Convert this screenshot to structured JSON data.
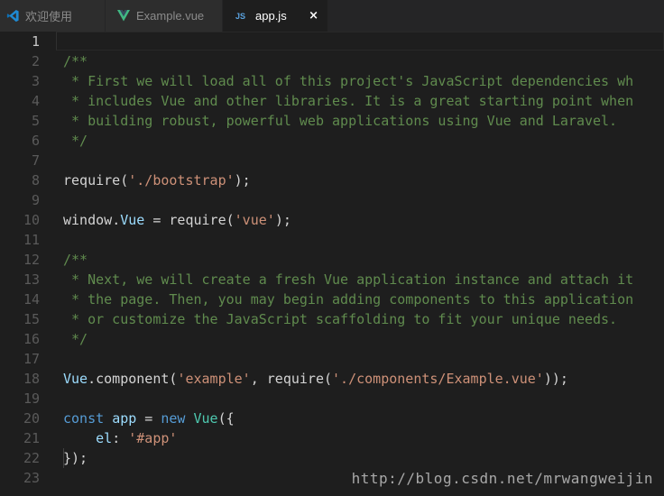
{
  "tabs": [
    {
      "label": "欢迎使用",
      "icon": "vscode-logo-icon",
      "active": false
    },
    {
      "label": "Example.vue",
      "icon": "vue-logo-icon",
      "active": false
    },
    {
      "label": "app.js",
      "icon": "js-file-icon",
      "badge": "JS",
      "active": true,
      "close": "×"
    }
  ],
  "editor": {
    "active_line": 1,
    "line_numbers": [
      "1",
      "2",
      "3",
      "4",
      "5",
      "6",
      "7",
      "8",
      "9",
      "10",
      "11",
      "12",
      "13",
      "14",
      "15",
      "16",
      "17",
      "18",
      "19",
      "20",
      "21",
      "22",
      "23"
    ],
    "lines": {
      "l2": "/**",
      "l3": " * First we will load all of this project's JavaScript dependencies wh",
      "l4": " * includes Vue and other libraries. It is a great starting point when",
      "l5": " * building robust, powerful web applications using Vue and Laravel.",
      "l6": " */",
      "l8": {
        "require": "require",
        "open": "(",
        "str": "'./bootstrap'",
        "close": ");"
      },
      "l10": {
        "window": "window",
        "dot": ".",
        "vue": "Vue",
        "eq": " = ",
        "require": "require",
        "open": "(",
        "str": "'vue'",
        "close": ");"
      },
      "l12": "/**",
      "l13": " * Next, we will create a fresh Vue application instance and attach it",
      "l14": " * the page. Then, you may begin adding components to this application",
      "l15": " * or customize the JavaScript scaffolding to fit your unique needs.",
      "l16": " */",
      "l18": {
        "vue": "Vue",
        "dot": ".",
        "component": "component",
        "open": "(",
        "str1": "'example'",
        "comma": ", ",
        "require": "require",
        "open2": "(",
        "str2": "'./components/Example.vue'",
        "close": "));"
      },
      "l20": {
        "const": "const",
        "sp1": " ",
        "app": "app",
        "eq": " = ",
        "new": "new",
        "sp2": " ",
        "vue": "Vue",
        "open": "({"
      },
      "l21": {
        "indent": "    ",
        "el": "el",
        "colon": ": ",
        "str": "'#app'"
      },
      "l22": "});"
    }
  },
  "watermark": "http://blog.csdn.net/mrwangweijin",
  "colors": {
    "background": "#1e1e1e",
    "comment": "#608b4e",
    "string": "#ce9178",
    "keyword": "#569cd6",
    "variable": "#9cdcfe",
    "class": "#4ec9b0",
    "function": "#dcdcaa"
  }
}
